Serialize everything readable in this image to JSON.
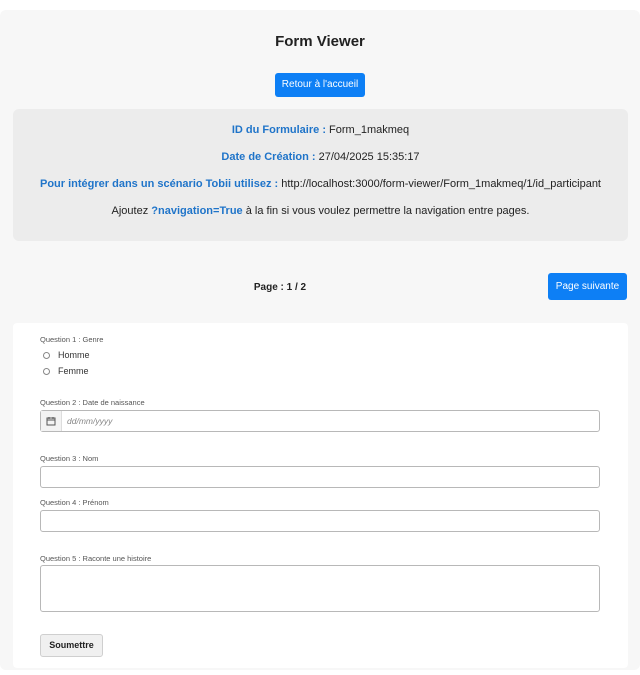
{
  "header": {
    "title": "Form Viewer",
    "home_button": "Retour à l'accueil"
  },
  "info": {
    "form_id_label": "ID du Formulaire :",
    "form_id_value": "Form_1makmeq",
    "date_label": "Date de Création :",
    "date_value": "27/04/2025 15:35:17",
    "integrate_label": "Pour intégrer dans un scénario Tobii utilisez :",
    "integrate_value": "http://localhost:3000/form-viewer/Form_1makmeq/1/id_participant",
    "nav_prefix": "Ajoutez",
    "nav_param": "?navigation=True",
    "nav_suffix": "à la fin si vous voulez permettre la navigation entre pages."
  },
  "pager": {
    "label": "Page : 1 / 2",
    "next_button": "Page suivante"
  },
  "form": {
    "q1": {
      "label": "Question 1 : Genre",
      "options": [
        "Homme",
        "Femme"
      ]
    },
    "q2": {
      "label": "Question 2 : Date de naissance",
      "placeholder": "dd/mm/yyyy"
    },
    "q3": {
      "label": "Question 3 : Nom",
      "value": ""
    },
    "q4": {
      "label": "Question 4 : Prénom",
      "value": ""
    },
    "q5": {
      "label": "Question 5 : Raconte une histoire",
      "value": ""
    },
    "submit_button": "Soumettre"
  },
  "colors": {
    "accent": "#0d7ff5",
    "key_text": "#1f74c9"
  },
  "icons": {
    "date": "calendar-icon"
  }
}
